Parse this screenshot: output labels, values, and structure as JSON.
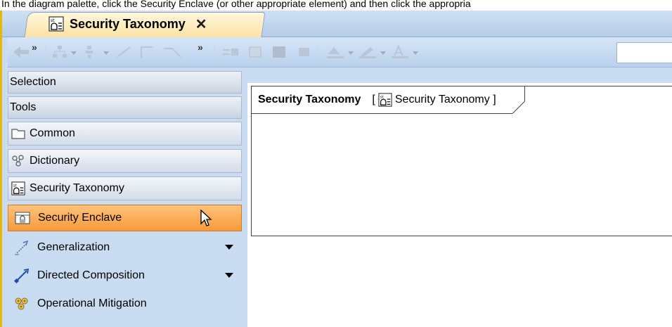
{
  "instruction": "In the diagram palette, click the Security Enclave (or other appropriate element) and then click the appropria",
  "tab": {
    "title": "Security Taxonomy",
    "close": "✕",
    "icon": "taxonomy-icon"
  },
  "toolbar": {
    "overflow_1": "»",
    "overflow_2": "»",
    "input_value": ""
  },
  "palette": {
    "selection_label": "Selection",
    "tools_label": "Tools",
    "groups": [
      {
        "label": "Common",
        "icon": "folder-icon"
      },
      {
        "label": "Dictionary",
        "icon": "dictionary-icon"
      },
      {
        "label": "Security Taxonomy",
        "icon": "taxonomy-icon"
      }
    ],
    "items": [
      {
        "label": "Security Enclave",
        "icon": "security-enclave-icon",
        "selected": true
      },
      {
        "label": "Generalization",
        "icon": "generalization-icon"
      },
      {
        "label": "Directed Composition",
        "icon": "directed-composition-icon"
      },
      {
        "label": "Operational Mitigation",
        "icon": "operational-mitigation-icon"
      }
    ]
  },
  "diagram": {
    "frame_name": "Security Taxonomy",
    "bracket_open": "[",
    "frame_type": "Security Taxonomy ]"
  },
  "colors": {
    "accent_tab": "#fbe3a4",
    "selected_item": "#f79a3b",
    "app_background": "#c9dcf1",
    "left_edge": "#e6b800"
  }
}
